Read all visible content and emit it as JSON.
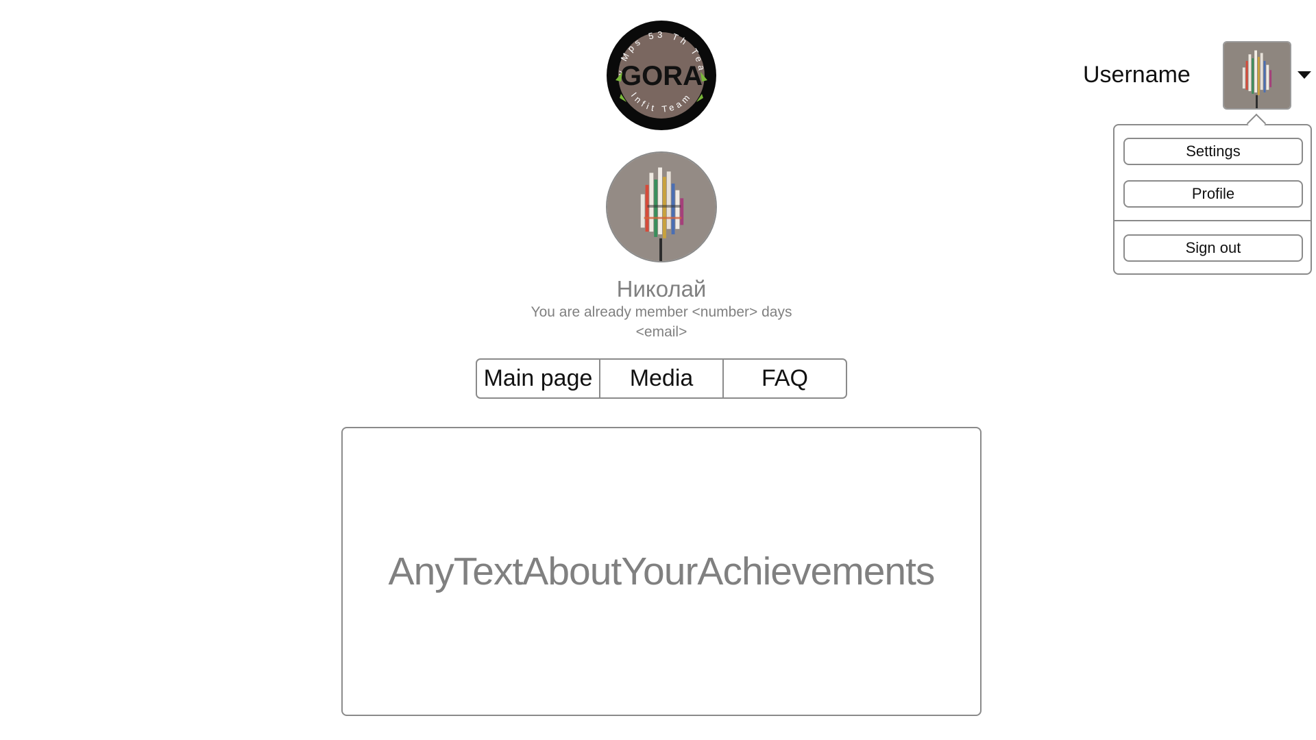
{
  "logo": {
    "ring_text_top": "By Mps 53 Th Team",
    "ring_text_bottom": "Infit Team",
    "center_text": "GORA",
    "colors": {
      "ring": "#0a0a0a",
      "center": "#7a6760",
      "accent": "#7ab83a"
    }
  },
  "profile": {
    "name": "Николай",
    "member_text": "You are already member <number> days",
    "email": "<email>",
    "avatar_icon": "sculpture-photo"
  },
  "nav": {
    "tabs": [
      {
        "label": "Main page"
      },
      {
        "label": "Media"
      },
      {
        "label": "FAQ"
      }
    ]
  },
  "content": {
    "text": "AnyTextAboutYourAchievements"
  },
  "header": {
    "username": "Username",
    "avatar_icon": "sculpture-photo",
    "caret_icon": "caret-down-icon"
  },
  "menu": {
    "settings_label": "Settings",
    "profile_label": "Profile",
    "signout_label": "Sign out"
  },
  "colors": {
    "border": "#8a8a8a",
    "muted_text": "#808080",
    "primary_text": "#111111"
  }
}
